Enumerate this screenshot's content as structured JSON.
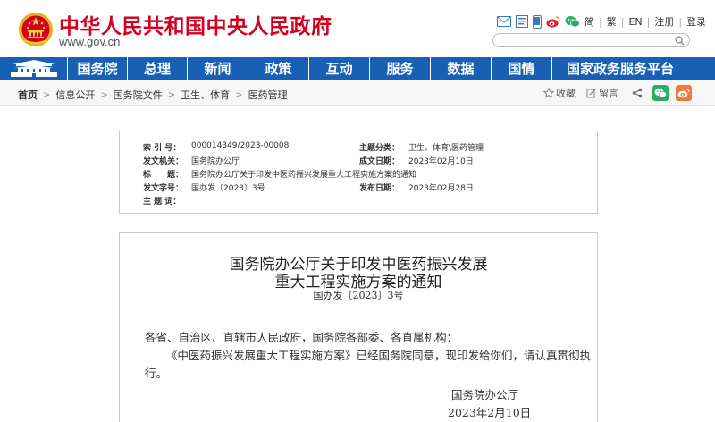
{
  "header": {
    "site_name": "中华人民共和国中央人民政府",
    "site_url": "www.gov.cn",
    "lang_links": [
      "简",
      "繁",
      "EN",
      "注册",
      "登录"
    ],
    "search_placeholder": ""
  },
  "nav": {
    "items": [
      "国务院",
      "总理",
      "新闻",
      "政策",
      "互动",
      "服务",
      "数据",
      "国情",
      "国家政务服务平台"
    ]
  },
  "breadcrumb": [
    "首页",
    "信息公开",
    "国务院文件",
    "卫生、体育",
    "医药管理"
  ],
  "tools": {
    "favorite": "收藏",
    "comment": "留言"
  },
  "info": {
    "index_label": "索 引 号：",
    "index_value": "000014349/2023-00008",
    "category_label": "主题分类：",
    "category_value": "卫生、体育\\医药管理",
    "issuer_label": "发文机关：",
    "issuer_value": "国务院办公厅",
    "written_label": "成文日期：",
    "written_value": "2023年02月10日",
    "title_label": "标　　题：",
    "title_value": "国务院办公厅关于印发中医药振兴发展重大工程实施方案的通知",
    "docno_label": "发文字号：",
    "docno_value": "国办发〔2023〕3号",
    "published_label": "发布日期：",
    "published_value": "2023年02月28日",
    "keywords_label": "主 题 词：",
    "keywords_value": ""
  },
  "article": {
    "title_line1": "国务院办公厅关于印发中医药振兴发展",
    "title_line2": "重大工程实施方案的通知",
    "doc_no": "国办发〔2023〕3号",
    "salutation": "各省、自治区、直辖市人民政府，国务院各部委、各直属机构：",
    "body_line1": "《中医药振兴发展重大工程实施方案》已经国务院同意，现印发给你们，请认真贯彻执",
    "body_line2": "行。",
    "signature": "国务院办公厅",
    "date": "2023年2月10日"
  },
  "colors": {
    "brand_red": "#d4001f",
    "nav_blue": "#1860b6",
    "wechat_green": "#2aae67",
    "weibo_orange": "#f07a3d"
  }
}
